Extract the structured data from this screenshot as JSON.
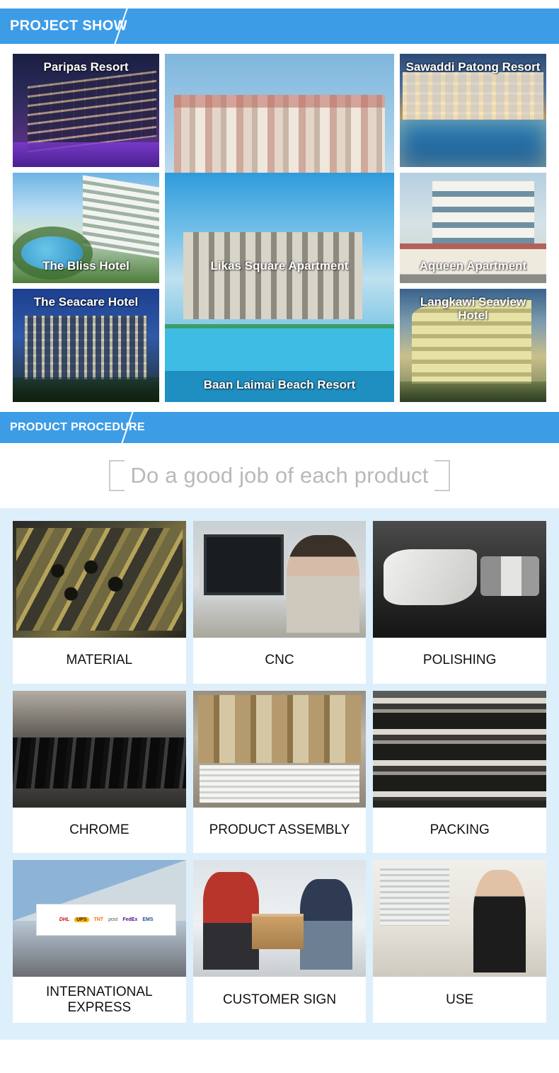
{
  "project_show": {
    "banner_label": "PROJECT SHOW",
    "tiles": [
      {
        "id": "paripas",
        "caption": "Paripas  Resort",
        "caption_position": "top"
      },
      {
        "id": "likas",
        "caption": "Likas Square Apartment",
        "caption_position": "bottom"
      },
      {
        "id": "sawaddi",
        "caption": "Sawaddi Patong Resort",
        "caption_position": "top"
      },
      {
        "id": "bliss",
        "caption": "The Bliss Hotel",
        "caption_position": "bottom"
      },
      {
        "id": "aqueen",
        "caption": "Aqueen Apartment",
        "caption_position": "bottom"
      },
      {
        "id": "seacare",
        "caption": "The Seacare Hotel",
        "caption_position": "top"
      },
      {
        "id": "baan",
        "caption": "Baan Laimai Beach Resort",
        "caption_position": "bottom"
      },
      {
        "id": "langkawi",
        "caption": "Langkawi Seaview Hotel",
        "caption_position": "top"
      }
    ]
  },
  "product_procedure": {
    "banner_label": "PRODUCT PROCEDURE",
    "slogan": "Do a good job of each product",
    "steps": [
      {
        "id": "material",
        "label": "MATERIAL"
      },
      {
        "id": "cnc",
        "label": "CNC"
      },
      {
        "id": "polishing",
        "label": "POLISHING"
      },
      {
        "id": "chrome",
        "label": "CHROME"
      },
      {
        "id": "assembly",
        "label": "PRODUCT ASSEMBLY"
      },
      {
        "id": "packing",
        "label": "PACKING"
      },
      {
        "id": "express",
        "label": "INTERNATIONAL EXPRESS"
      },
      {
        "id": "customer",
        "label": "CUSTOMER SIGN"
      },
      {
        "id": "use",
        "label": "USE"
      }
    ],
    "express_carriers": [
      "DHL",
      "UPS",
      "TNT",
      "post",
      "FedEx",
      "EMS"
    ]
  },
  "colors": {
    "banner_blue": "#3d9ce6",
    "procedure_background": "#ddeffb",
    "slogan_gray": "#b9b9b9",
    "card_white": "#ffffff"
  }
}
